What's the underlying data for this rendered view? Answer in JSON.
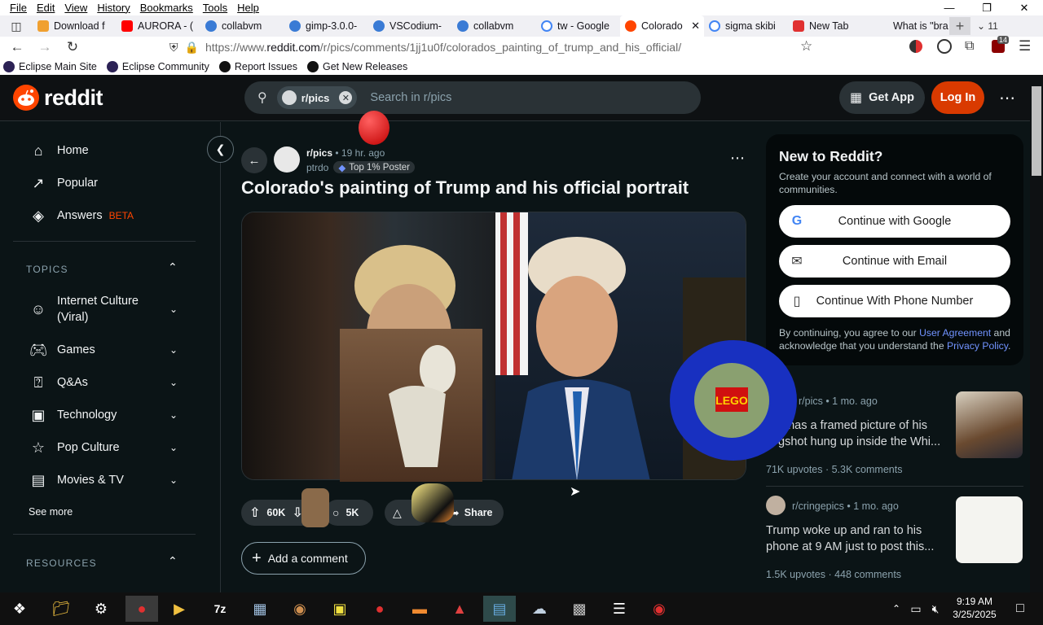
{
  "menubar": [
    "File",
    "Edit",
    "View",
    "History",
    "Bookmarks",
    "Tools",
    "Help"
  ],
  "tabs": [
    {
      "label": "Download f",
      "color": "#f0a030"
    },
    {
      "label": "AURORA - (",
      "color": "#ff0000"
    },
    {
      "label": "collabvm",
      "color": "#3a7bd5"
    },
    {
      "label": "gimp-3.0.0-",
      "color": "#3a7bd5"
    },
    {
      "label": "VSCodium-",
      "color": "#3a7bd5"
    },
    {
      "label": "collabvm",
      "color": "#3a7bd5"
    },
    {
      "label": "tw - Google",
      "color": "#4285f4"
    },
    {
      "label": "Colorado",
      "color": "#ff4500"
    },
    {
      "label": "sigma skibi",
      "color": "#4285f4"
    },
    {
      "label": "New Tab",
      "color": "#e03030"
    },
    {
      "label": "What is \"bra",
      "color": "#cccccc"
    }
  ],
  "tab_overflow_count": "11",
  "url": {
    "prefix": "https://www.",
    "host": "reddit.com",
    "path": "/r/pics/comments/1jj1u0f/colorados_painting_of_trump_and_his_official/"
  },
  "ext_badge": "14",
  "bookmarks": [
    "Eclipse Main Site",
    "Eclipse Community",
    "Report Issues",
    "Get New Releases"
  ],
  "header": {
    "logo": "reddit",
    "search_chip": "r/pics",
    "search_placeholder": "Search in r/pics",
    "get_app": "Get App",
    "login": "Log In"
  },
  "leftnav": {
    "main": [
      "Home",
      "Popular",
      "Answers"
    ],
    "answers_badge": "BETA",
    "topics_label": "TOPICS",
    "topics": [
      {
        "label": "Internet Culture\n(Viral)"
      },
      {
        "label": "Games"
      },
      {
        "label": "Q&As"
      },
      {
        "label": "Technology"
      },
      {
        "label": "Pop Culture"
      },
      {
        "label": "Movies & TV"
      }
    ],
    "see_more": "See more",
    "resources_label": "RESOURCES"
  },
  "post": {
    "subreddit": "r/pics",
    "time": "19 hr. ago",
    "author": "ptrdo",
    "flair": "Top 1% Poster",
    "title": "Colorado's painting of Trump and his official portrait",
    "upvotes": "60K",
    "comments": "5K",
    "share": "Share",
    "add_comment": "Add a comment"
  },
  "signup": {
    "title": "New to Reddit?",
    "subtitle": "Create your account and connect with a world of communities.",
    "google": "Continue with Google",
    "email": "Continue with Email",
    "phone": "Continue With Phone Number",
    "legal_pre": "By continuing, you agree to our ",
    "legal_link1": "User Agreement",
    "legal_mid": " and acknowledge that you understand the ",
    "legal_link2": "Privacy Policy",
    "legal_end": "."
  },
  "related": [
    {
      "meta": "r/pics • 1 mo. ago",
      "title": "p has a framed picture of his gshot hung up inside the Whi...",
      "stats": "71K upvotes  ·  5.3K comments"
    },
    {
      "meta": "r/cringepics • 1 mo. ago",
      "title": "Trump woke up and ran to his phone at 9 AM just to post this...",
      "stats": "1.5K upvotes  ·  448 comments"
    }
  ],
  "clock": {
    "time": "9:19 AM",
    "date": "3/25/2025"
  },
  "colors": {
    "accent": "#ff4500",
    "login": "#d93a00",
    "bg": "#0b1416",
    "link": "#7193ff"
  }
}
